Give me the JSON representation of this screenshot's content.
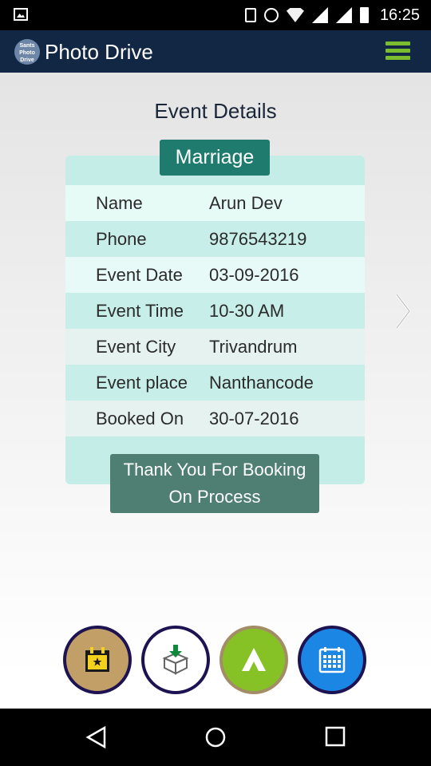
{
  "status_bar": {
    "time": "16:25"
  },
  "app_bar": {
    "logo_text": "Sants Photo Drive",
    "title": "Photo Drive"
  },
  "page": {
    "title": "Event Details"
  },
  "event": {
    "type": "Marriage",
    "fields": [
      {
        "label": "Name",
        "value": "Arun Dev"
      },
      {
        "label": "Phone",
        "value": "9876543219"
      },
      {
        "label": "Event Date",
        "value": "03-09-2016"
      },
      {
        "label": "Event Time",
        "value": "10-30 AM"
      },
      {
        "label": "Event City",
        "value": "Trivandrum"
      },
      {
        "label": "Event place",
        "value": "Nanthancode"
      },
      {
        "label": "Booked On",
        "value": "30-07-2016"
      }
    ],
    "status_line1": "Thank You For Booking",
    "status_line2": "On Process"
  },
  "bottom_buttons": [
    "event-calendar-icon",
    "download-box-icon",
    "upload-arrow-icon",
    "calendar-grid-icon"
  ],
  "colors": {
    "app_bar": "#122744",
    "accent_green": "#7cbd2f",
    "badge": "#1e7b6d",
    "status_box": "#4e7f72"
  }
}
